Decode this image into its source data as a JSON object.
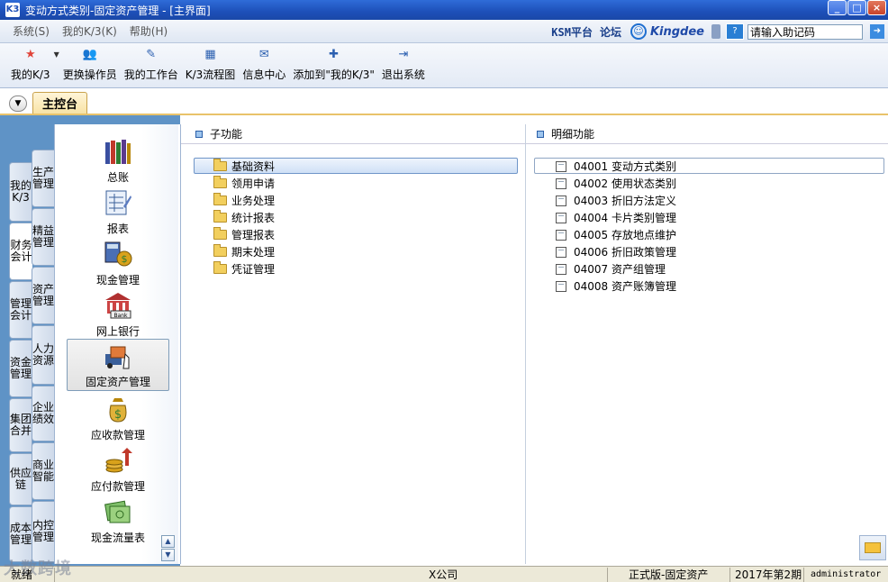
{
  "window": {
    "title": "变动方式类别-固定资产管理 - [主界面]",
    "app_icon": "K3"
  },
  "menu": [
    "系统(S)",
    "我的K/3(K)",
    "帮助(H)"
  ],
  "brand": {
    "ksm": "KSM平台",
    "forum": "论坛",
    "kingdee": "Kingdee",
    "help_placeholder": "请输入助记码"
  },
  "toolbar": [
    {
      "label": "我的K/3",
      "icon": "star-icon"
    },
    {
      "label": "更换操作员",
      "icon": "users-icon"
    },
    {
      "label": "我的工作台",
      "icon": "pen-icon"
    },
    {
      "label": "K/3流程图",
      "icon": "flowchart-icon"
    },
    {
      "label": "信息中心",
      "icon": "message-icon"
    },
    {
      "label": "添加到\"我的K/3\"",
      "icon": "add-icon"
    },
    {
      "label": "退出系统",
      "icon": "exit-icon"
    }
  ],
  "tabs": {
    "main": "主控台"
  },
  "vtabs_outer": [
    "我的K/3",
    "财务会计",
    "管理会计",
    "资金管理",
    "集团合并",
    "供应链",
    "成本管理"
  ],
  "vtabs_inner": [
    "生产管理",
    "精益管理",
    "资产管理",
    "人力资源",
    "企业绩效",
    "商业智能",
    "内控管理"
  ],
  "modules": [
    "总账",
    "报表",
    "现金管理",
    "网上银行",
    "固定资产管理",
    "应收款管理",
    "应付款管理",
    "现金流量表"
  ],
  "subfunctions": {
    "header": "子功能",
    "items": [
      "基础资料",
      "领用申请",
      "业务处理",
      "统计报表",
      "管理报表",
      "期末处理",
      "凭证管理"
    ]
  },
  "details": {
    "header": "明细功能",
    "items": [
      {
        "code": "04001",
        "name": "变动方式类别"
      },
      {
        "code": "04002",
        "name": "使用状态类别"
      },
      {
        "code": "04003",
        "name": "折旧方法定义"
      },
      {
        "code": "04004",
        "name": "卡片类别管理"
      },
      {
        "code": "04005",
        "name": "存放地点维护"
      },
      {
        "code": "04006",
        "name": "折旧政策管理"
      },
      {
        "code": "04007",
        "name": "资产组管理"
      },
      {
        "code": "04008",
        "name": "资产账簿管理"
      }
    ]
  },
  "status": {
    "ready": "就绪",
    "company": "X公司",
    "edition": "正式版-固定资产",
    "period": "2017年第2期",
    "user": "administrator",
    "watermark": "大数跨境"
  }
}
